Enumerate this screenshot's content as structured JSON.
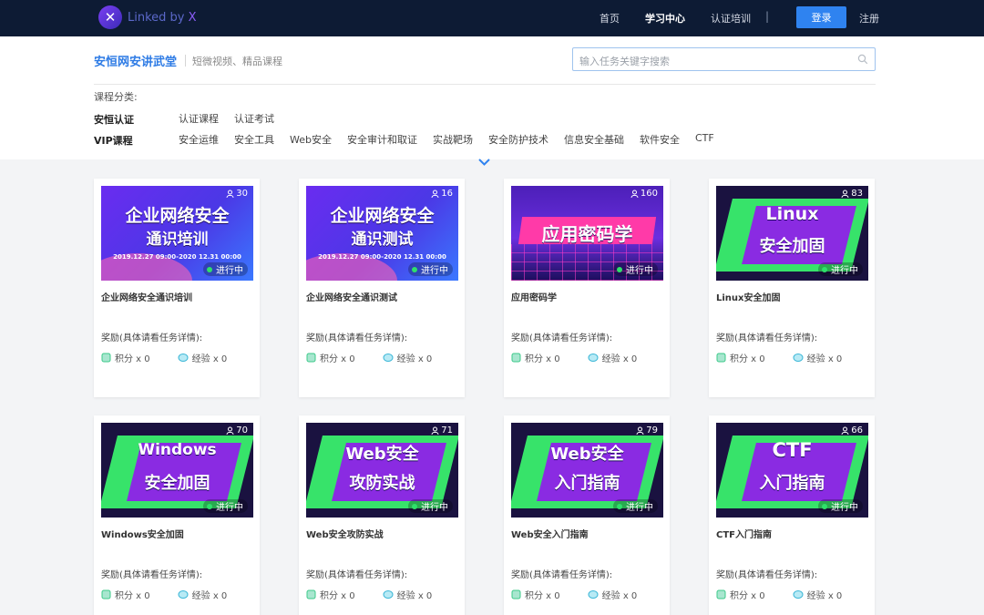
{
  "nav": {
    "logo_text": "Linked by",
    "logo_x": "X",
    "items": [
      "首页",
      "学习中心",
      "认证培训"
    ],
    "separator": "|",
    "login": "登录",
    "register": "注册"
  },
  "header": {
    "title": "安恒网安讲武堂",
    "subtitle": "短微视频、精品课程",
    "search_placeholder": "输入任务关键字搜索"
  },
  "categories": {
    "label": "课程分类:",
    "rows": [
      {
        "label": "安恒认证",
        "items": [
          "认证课程",
          "认证考试"
        ]
      },
      {
        "label": "VIP课程",
        "items": [
          "安全运维",
          "安全工具",
          "Web安全",
          "安全审计和取证",
          "实战靶场",
          "安全防护技术",
          "信息安全基础",
          "软件安全",
          "CTF"
        ]
      }
    ]
  },
  "reward_label": "奖励(具体请看任务详情):",
  "points_label": "积分 x 0",
  "exp_label": "经验 x 0",
  "status_label": "进行中",
  "courses": [
    {
      "title": "企业网络安全通识培训",
      "count": "30",
      "thumb_line1": "企业网络安全",
      "thumb_line2": "通识培训",
      "thumb_date": "2019.12.27 09:00-2020 12.31 00:00"
    },
    {
      "title": "企业网络安全通识测试",
      "count": "16",
      "thumb_line1": "企业网络安全",
      "thumb_line2": "通识测试",
      "thumb_date": "2019.12.27 09:00-2020 12.31 00:00"
    },
    {
      "title": "应用密码学",
      "count": "160",
      "thumb_line1": "应用密码学"
    },
    {
      "title": "Linux安全加固",
      "count": "83",
      "thumb_line1": "Linux",
      "thumb_line2": "安全加固"
    },
    {
      "title": "Windows安全加固",
      "count": "70",
      "thumb_line1": "Windows",
      "thumb_line2": "安全加固"
    },
    {
      "title": "Web安全攻防实战",
      "count": "71",
      "thumb_line1": "Web安全",
      "thumb_line2": "攻防实战"
    },
    {
      "title": "Web安全入门指南",
      "count": "79",
      "thumb_line1": "Web安全",
      "thumb_line2": "入门指南"
    },
    {
      "title": "CTF入门指南",
      "count": "66",
      "thumb_line1": "CTF",
      "thumb_line2": "入门指南"
    }
  ]
}
